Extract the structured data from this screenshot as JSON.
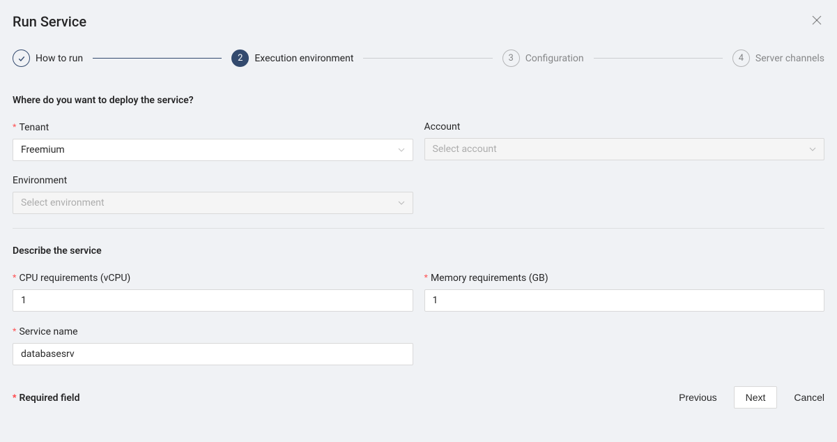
{
  "title": "Run Service",
  "steps": {
    "step1": {
      "label": "How to run"
    },
    "step2": {
      "number": "2",
      "label": "Execution environment"
    },
    "step3": {
      "number": "3",
      "label": "Configuration"
    },
    "step4": {
      "number": "4",
      "label": "Server channels"
    }
  },
  "section1": {
    "title": "Where do you want to deploy the service?",
    "tenant": {
      "label": "Tenant",
      "value": "Freemium"
    },
    "account": {
      "label": "Account",
      "placeholder": "Select account"
    },
    "environment": {
      "label": "Environment",
      "placeholder": "Select environment"
    }
  },
  "section2": {
    "title": "Describe the service",
    "cpu": {
      "label": "CPU requirements (vCPU)",
      "value": "1"
    },
    "memory": {
      "label": "Memory requirements (GB)",
      "value": "1"
    },
    "serviceName": {
      "label": "Service name",
      "value": "databasesrv"
    }
  },
  "requiredNote": "Required field",
  "buttons": {
    "previous": "Previous",
    "next": "Next",
    "cancel": "Cancel"
  }
}
